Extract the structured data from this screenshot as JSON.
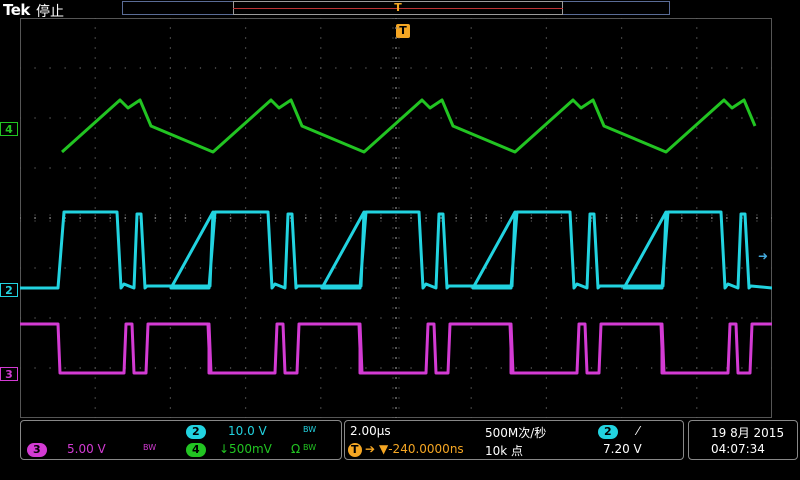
{
  "header": {
    "brand": "Tek",
    "state": "停止"
  },
  "trigger_marker": "T",
  "channels": {
    "ch4": {
      "marker": "4",
      "color": "#22c422"
    },
    "ch2": {
      "marker": "2",
      "color": "#22d3e0"
    },
    "ch3": {
      "marker": "3",
      "color": "#d33bd3"
    }
  },
  "readouts": {
    "ch2": {
      "label": "2",
      "volts": "10.0 V",
      "bw": "BW"
    },
    "ch3": {
      "label": "3",
      "volts": "5.00 V",
      "bw": "BW"
    },
    "ch4": {
      "label": "4",
      "volts": "↓500mV",
      "extra": "Ω",
      "bw": "BW"
    },
    "timebase": "2.00μs",
    "sample_rate": "500M次/秒",
    "trigger_offset": "▼-240.0000ns",
    "record_length": "10k 点",
    "trigger_source": "2",
    "trigger_slope": "⁄",
    "trigger_level": "7.20 V",
    "date": "19 8月 2015",
    "time": "04:07:34"
  }
}
